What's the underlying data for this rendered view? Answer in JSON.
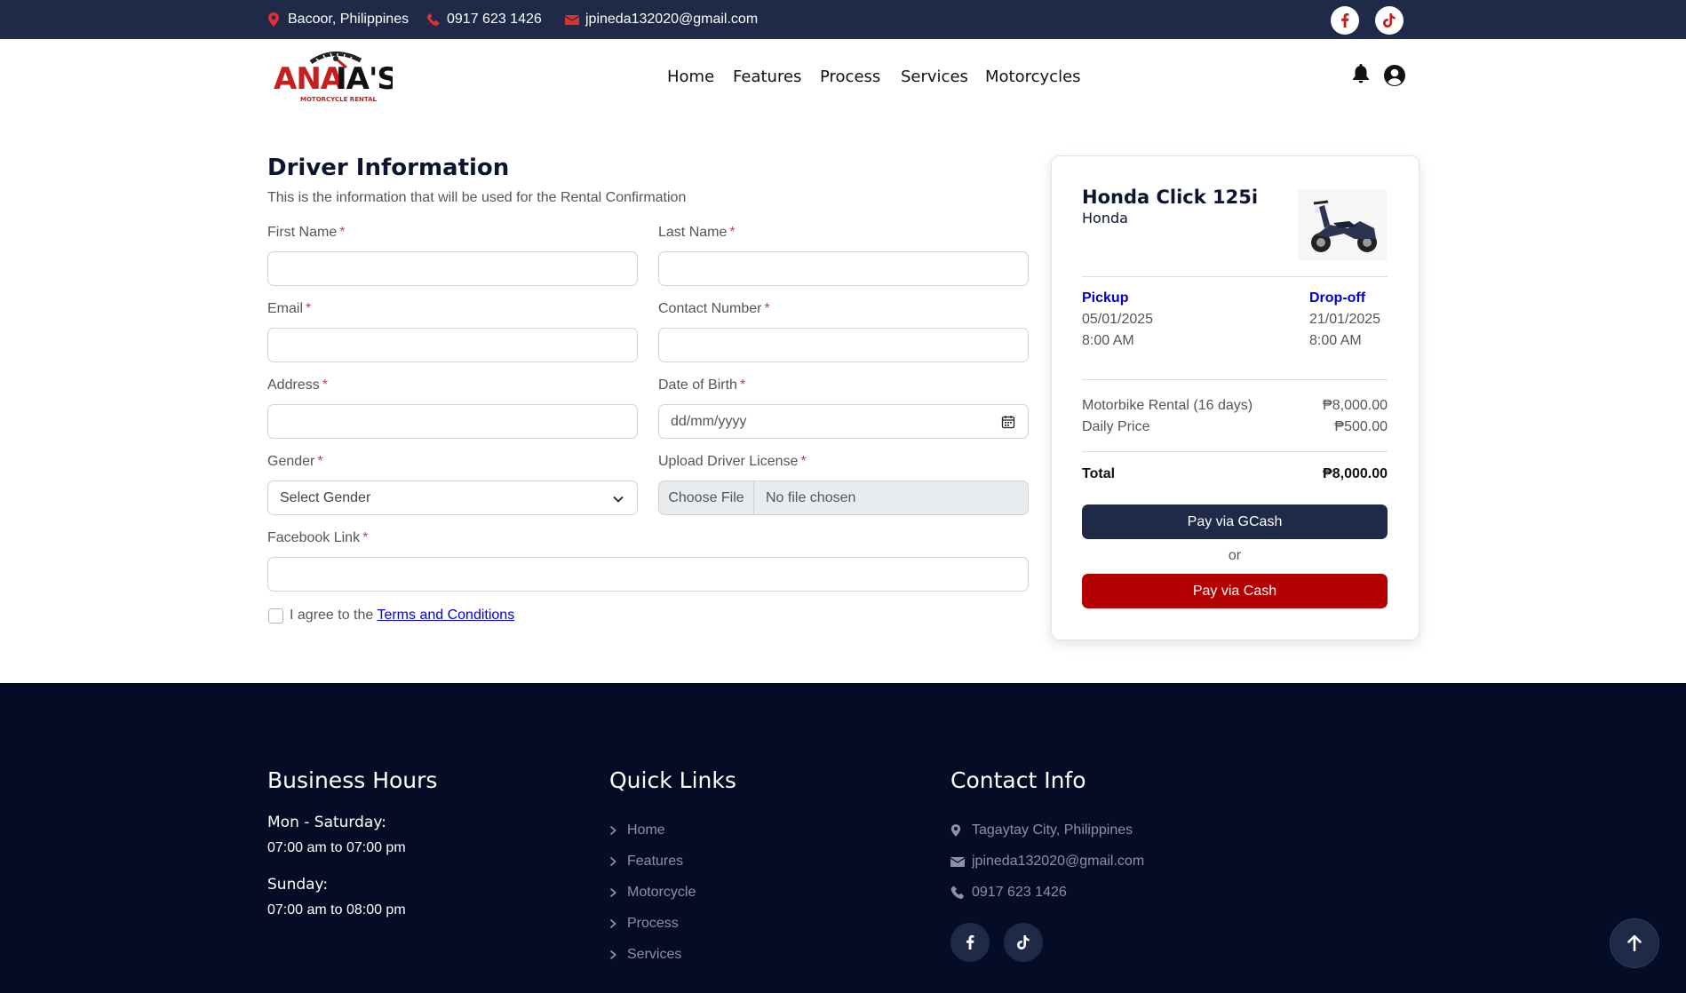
{
  "topbar": {
    "location": "Bacoor, Philippines",
    "phone": "0917 623 1426",
    "email": "jpineda132020@gmail.com"
  },
  "nav": {
    "logo_text": "ANAIA'S",
    "logo_tagline": "MOTORCYCLE RENTAL",
    "items": [
      "Home",
      "Features",
      "Process",
      "Services",
      "Motorcycles"
    ]
  },
  "form": {
    "title": "Driver Information",
    "subtitle": "This is the information that will be used for the Rental Confirmation",
    "first_name_label": "First Name",
    "last_name_label": "Last Name",
    "email_label": "Email",
    "contact_label": "Contact Number",
    "address_label": "Address",
    "dob_label": "Date of Birth",
    "dob_placeholder": "dd/mm/yyyy",
    "gender_label": "Gender",
    "gender_selected": "Select Gender",
    "license_label": "Upload Driver License",
    "choose_file": "Choose File",
    "no_file": "No file chosen",
    "facebook_label": "Facebook Link",
    "required_mark": "*",
    "agree_text": "I agree to the",
    "terms_link": "Terms and Conditions"
  },
  "summary": {
    "bike_name": "Honda Click 125i",
    "brand": "Honda",
    "pickup_label": "Pickup",
    "pickup_date": "05/01/2025",
    "pickup_time": "8:00 AM",
    "dropoff_label": "Drop-off",
    "dropoff_date": "21/01/2025",
    "dropoff_time": "8:00 AM",
    "rental_label": "Motorbike Rental (16 days)",
    "rental_value": "₱8,000.00",
    "daily_label": "Daily Price",
    "daily_value": "₱500.00",
    "total_label": "Total",
    "total_value": "₱8,000.00",
    "gcash_button": "Pay via GCash",
    "or_text": "or",
    "cash_button": "Pay via Cash"
  },
  "footer": {
    "hours_title": "Business Hours",
    "weekday_label": "Mon - Saturday:",
    "weekday_hours": "07:00 am to 07:00 pm",
    "sunday_label": "Sunday:",
    "sunday_hours": "07:00 am to 08:00 pm",
    "links_title": "Quick Links",
    "links": [
      "Home",
      "Features",
      "Motorcycle",
      "Process",
      "Services"
    ],
    "contact_title": "Contact Info",
    "contact_location": "Tagaytay City, Philippines",
    "contact_email": "jpineda132020@gmail.com",
    "contact_phone": "0917 623 1426"
  },
  "colors": {
    "navy": "#1f2a48",
    "footer": "#050d26",
    "brand_red": "#b30000",
    "link_blue": "#0000cc"
  },
  "icons": [
    "map-pin-icon",
    "phone-icon",
    "envelope-icon",
    "facebook-icon",
    "tiktok-icon",
    "bell-icon",
    "user-circle-icon",
    "calendar-icon",
    "chevron-down-icon",
    "chevron-right-icon",
    "arrow-up-icon"
  ]
}
